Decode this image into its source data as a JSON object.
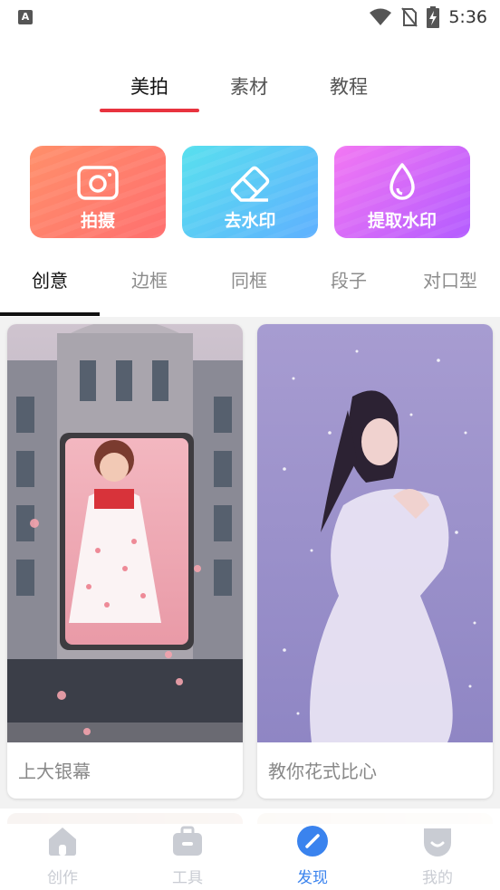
{
  "status_bar": {
    "time": "5:36",
    "left_icon_letter": "A",
    "icons": [
      "wifi-icon",
      "no-sim-icon",
      "battery-charging-icon"
    ]
  },
  "top_tabs": [
    {
      "label": "美拍",
      "active": true
    },
    {
      "label": "素材",
      "active": false
    },
    {
      "label": "教程",
      "active": false
    }
  ],
  "features": [
    {
      "label": "拍摄",
      "icon": "camera-icon",
      "color_from": "#ff8f6a",
      "color_to": "#ff6f6f"
    },
    {
      "label": "去水印",
      "icon": "eraser-icon",
      "color_from": "#58e0ee",
      "color_to": "#5fb0ff"
    },
    {
      "label": "提取水印",
      "icon": "water-drop-icon",
      "color_from": "#f377f3",
      "color_to": "#b35cff"
    }
  ],
  "category_tabs": [
    {
      "label": "创意",
      "active": true
    },
    {
      "label": "边框",
      "active": false
    },
    {
      "label": "同框",
      "active": false
    },
    {
      "label": "段子",
      "active": false
    },
    {
      "label": "对口型",
      "active": false
    }
  ],
  "cards": [
    {
      "caption": "上大银幕"
    },
    {
      "caption": "教你花式比心"
    }
  ],
  "bottom_nav": [
    {
      "label": "创作",
      "icon": "home-icon",
      "active": false
    },
    {
      "label": "工具",
      "icon": "toolbox-icon",
      "active": false
    },
    {
      "label": "发现",
      "icon": "compass-icon",
      "active": true
    },
    {
      "label": "我的",
      "icon": "profile-icon",
      "active": false
    }
  ],
  "colors": {
    "accent_red": "#e8333f",
    "active_blue": "#3a83ee",
    "inactive_nav": "#c9ccd3"
  }
}
